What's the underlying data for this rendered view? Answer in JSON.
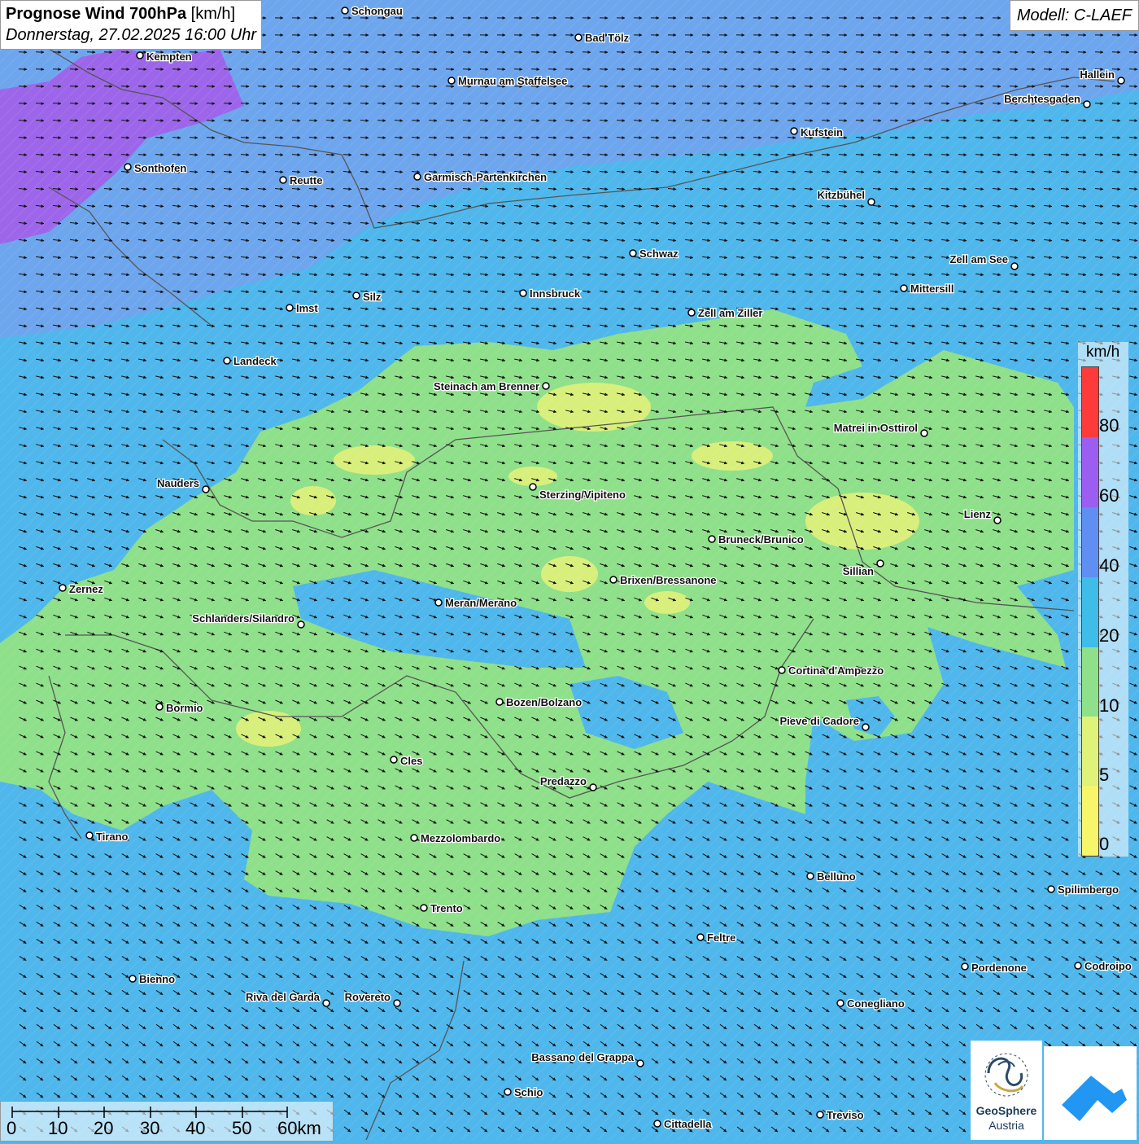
{
  "title": {
    "main_bold": "Prognose Wind 700hPa",
    "main_unit": " [km/h]",
    "subtitle": "Donnerstag, 27.02.2025 16:00 Uhr"
  },
  "model": "Modell: C-LAEF",
  "legend": {
    "unit": "km/h",
    "labels": [
      "80",
      "60",
      "40",
      "20",
      "10",
      "5",
      "0"
    ],
    "colors": [
      "#ff3a3a",
      "#9c5ef0",
      "#5f8ff2",
      "#3ebde8",
      "#8fe08a",
      "#dff27a",
      "#f7f56a"
    ]
  },
  "scalebar": {
    "labels": [
      "0",
      "10",
      "20",
      "30",
      "40",
      "50",
      "60km"
    ]
  },
  "logos": {
    "geosphere_name": "GeoSphere",
    "geosphere_sub": "Austria"
  },
  "colors": {
    "purple_zone": "#9d66ea",
    "blue_zone": "#6ea6ee",
    "cyan_zone": "#4fb7ec",
    "green_zone": "#8fe08a",
    "yellow_zone": "#d9ef7b",
    "border_line": "#555555"
  },
  "cities": [
    {
      "name": "Schongau"
    },
    {
      "name": "Bad Tölz"
    },
    {
      "name": "Kempten"
    },
    {
      "name": "Murnau am Staffelsee"
    },
    {
      "name": "Hallein"
    },
    {
      "name": "Berchtesgaden"
    },
    {
      "name": "Kufstein"
    },
    {
      "name": "Sonthofen"
    },
    {
      "name": "Reutte"
    },
    {
      "name": "Garmisch-Partenkirchen"
    },
    {
      "name": "Kitzbühel"
    },
    {
      "name": "Schwaz"
    },
    {
      "name": "Zell am See"
    },
    {
      "name": "Mittersill"
    },
    {
      "name": "Imst"
    },
    {
      "name": "Silz"
    },
    {
      "name": "Innsbruck"
    },
    {
      "name": "Zell am Ziller"
    },
    {
      "name": "Landeck"
    },
    {
      "name": "Steinach am Brenner"
    },
    {
      "name": "Matrei in Osttirol"
    },
    {
      "name": "Nauders"
    },
    {
      "name": "Sterzing/Vipiteno"
    },
    {
      "name": "Lienz"
    },
    {
      "name": "Bruneck/Brunico"
    },
    {
      "name": "Sillian"
    },
    {
      "name": "Zernez"
    },
    {
      "name": "Brixen/Bressanone"
    },
    {
      "name": "Meran/Merano"
    },
    {
      "name": "Schlanders/Silandro"
    },
    {
      "name": "Cortina d'Ampezzo"
    },
    {
      "name": "Bozen/Bolzano"
    },
    {
      "name": "Bormio"
    },
    {
      "name": "Pieve di Cadore"
    },
    {
      "name": "Cles"
    },
    {
      "name": "Predazzo"
    },
    {
      "name": "Tirano"
    },
    {
      "name": "Mezzolombardo"
    },
    {
      "name": "Belluno"
    },
    {
      "name": "Spilimbergo"
    },
    {
      "name": "Trento"
    },
    {
      "name": "Feltre"
    },
    {
      "name": "Pordenone"
    },
    {
      "name": "Codroipo"
    },
    {
      "name": "Bienno"
    },
    {
      "name": "Riva del Garda"
    },
    {
      "name": "Rovereto"
    },
    {
      "name": "Conegliano"
    },
    {
      "name": "Bassano del Grappa"
    },
    {
      "name": "Schio"
    },
    {
      "name": "Treviso"
    },
    {
      "name": "Cittadella"
    }
  ]
}
